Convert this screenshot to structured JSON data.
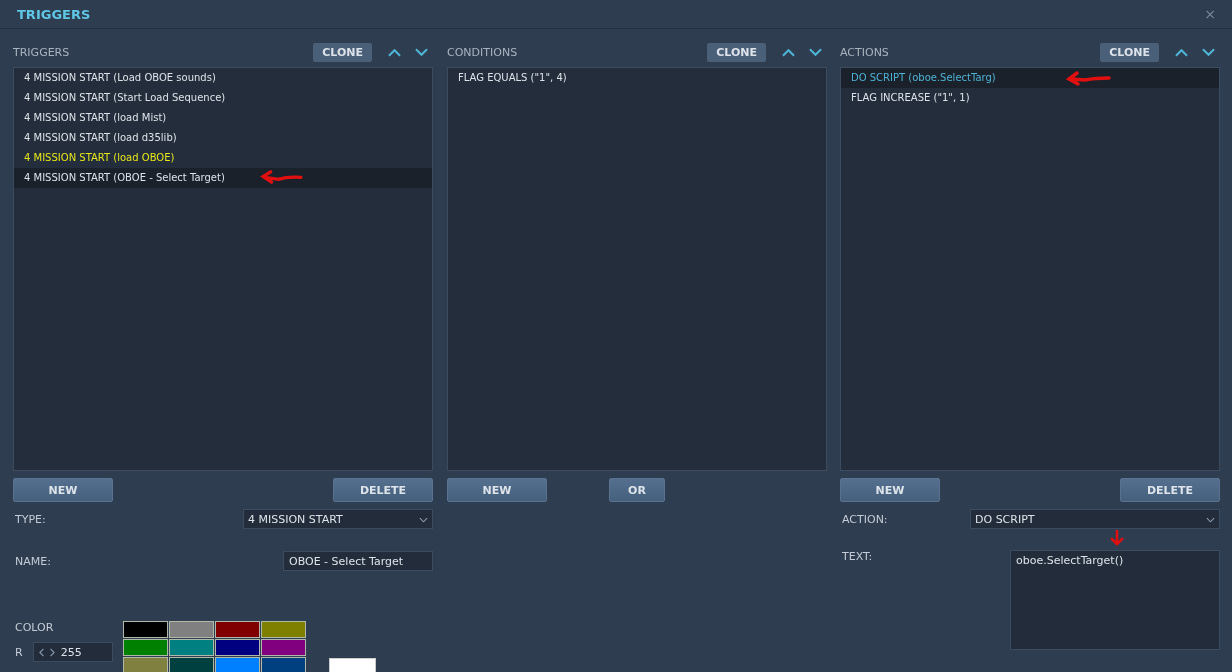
{
  "window": {
    "title": "TRIGGERS",
    "close": "×"
  },
  "triggers": {
    "header": "TRIGGERS",
    "clone": "CLONE",
    "items": [
      {
        "label": "4 MISSION START (Load OBOE sounds)",
        "color": "#dde3ea",
        "selected": false
      },
      {
        "label": "4 MISSION START (Start Load Sequence)",
        "color": "#dde3ea",
        "selected": false
      },
      {
        "label": "4 MISSION START (load Mist)",
        "color": "#dde3ea",
        "selected": false
      },
      {
        "label": "4 MISSION START (load d35lib)",
        "color": "#dde3ea",
        "selected": false
      },
      {
        "label": "4 MISSION START (load OBOE)",
        "color": "#e6e61a",
        "selected": false
      },
      {
        "label": "4 MISSION START (OBOE - Select Target)",
        "color": "#dde3ea",
        "selected": true
      }
    ],
    "new": "NEW",
    "delete": "DELETE",
    "type_label": "TYPE:",
    "type_value": "4 MISSION START",
    "name_label": "NAME:",
    "name_value": "OBOE - Select Target",
    "color_label": "COLOR",
    "r_label": "R",
    "r_value": "255",
    "swatches": [
      {
        "color": "#000000"
      },
      {
        "color": "#808080"
      },
      {
        "color": "#800000"
      },
      {
        "color": "#808000"
      },
      {
        "color": "#008000"
      },
      {
        "color": "#008080"
      },
      {
        "color": "#000080"
      },
      {
        "color": "#800080"
      },
      {
        "color": "#808040"
      },
      {
        "color": "#004040"
      },
      {
        "color": "#0080ff"
      },
      {
        "color": "#004080"
      }
    ]
  },
  "conditions": {
    "header": "CONDITIONS",
    "clone": "CLONE",
    "items": [
      {
        "label": "FLAG EQUALS (\"1\", 4)",
        "color": "#dde3ea",
        "selected": false
      }
    ],
    "new": "NEW",
    "or": "OR"
  },
  "actions": {
    "header": "ACTIONS",
    "clone": "CLONE",
    "items": [
      {
        "label": "DO SCRIPT (oboe.SelectTarg)",
        "color": "#4fb3d4",
        "selected": true
      },
      {
        "label": "FLAG INCREASE (\"1\", 1)",
        "color": "#dde3ea",
        "selected": false
      }
    ],
    "new": "NEW",
    "delete": "DELETE",
    "action_label": "ACTION:",
    "action_value": "DO SCRIPT",
    "text_label": "TEXT:",
    "text_value": "oboe.SelectTarget()"
  }
}
